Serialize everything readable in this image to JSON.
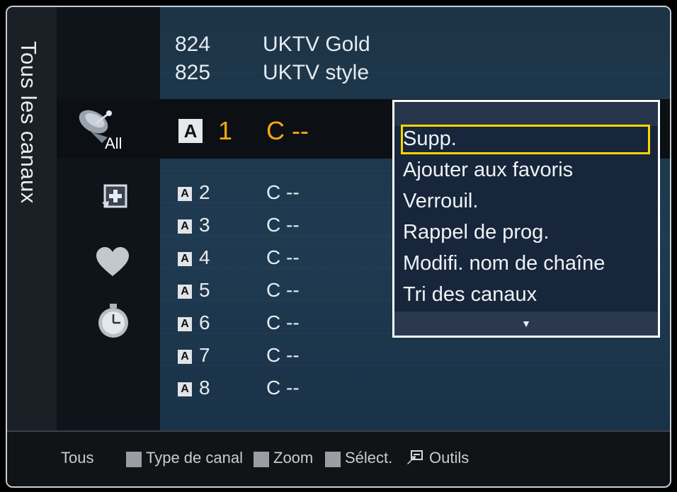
{
  "sidebar": {
    "title": "Tous les canaux",
    "icons": [
      "satellite-dish-icon",
      "add-channel-icon",
      "heart-icon",
      "timer-icon"
    ],
    "all_label": "All"
  },
  "channels_top": [
    {
      "num": "824",
      "name": "UKTV Gold"
    },
    {
      "num": "825",
      "name": "UKTV style"
    }
  ],
  "selected_channel": {
    "badge": "A",
    "num": "1",
    "name": "C --",
    "color": "#f7a813"
  },
  "channels": [
    {
      "badge": "A",
      "num": "2",
      "name": "C --"
    },
    {
      "badge": "A",
      "num": "3",
      "name": "C --"
    },
    {
      "badge": "A",
      "num": "4",
      "name": "C --"
    },
    {
      "badge": "A",
      "num": "5",
      "name": "C --"
    },
    {
      "badge": "A",
      "num": "6",
      "name": "C --"
    },
    {
      "badge": "A",
      "num": "7",
      "name": "C --"
    },
    {
      "badge": "A",
      "num": "8",
      "name": "C --"
    }
  ],
  "tools_menu": {
    "items": [
      "Supp.",
      "Ajouter aux favoris",
      "Verrouil.",
      "Rappel de prog.",
      "Modifi. nom de chaîne",
      "Tri des canaux"
    ],
    "selected": "Supp.",
    "more_arrow": "▼",
    "highlight_color": "#ffd400"
  },
  "footer": {
    "tous": "Tous",
    "type": "Type de canal",
    "zoom": "Zoom",
    "select": "Sélect.",
    "tools": "Outils"
  }
}
